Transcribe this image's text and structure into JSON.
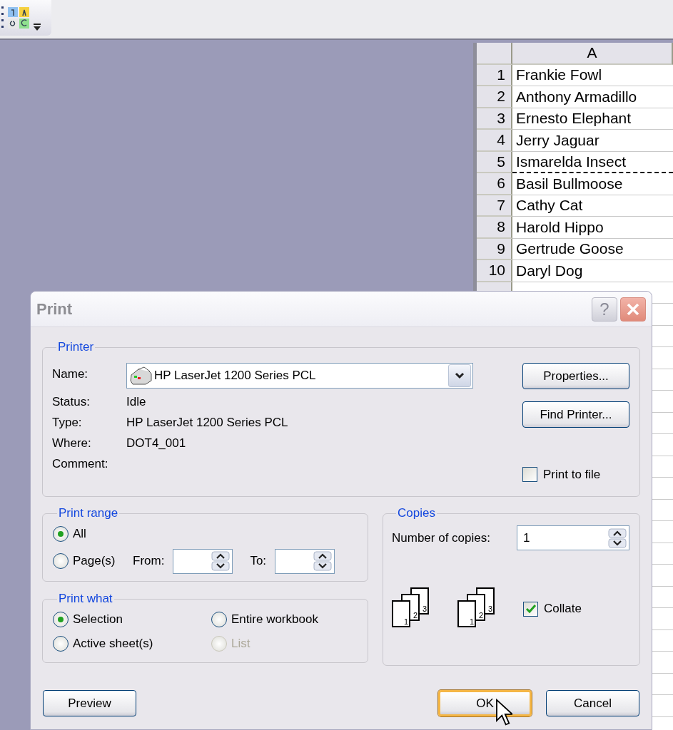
{
  "sheet": {
    "columns": [
      "A"
    ],
    "rows": [
      {
        "number": "1",
        "cells": [
          "Frankie Fowl"
        ],
        "page_break": false
      },
      {
        "number": "2",
        "cells": [
          "Anthony Armadillo"
        ],
        "page_break": false
      },
      {
        "number": "3",
        "cells": [
          "Ernesto Elephant"
        ],
        "page_break": false
      },
      {
        "number": "4",
        "cells": [
          "Jerry Jaguar"
        ],
        "page_break": false
      },
      {
        "number": "5",
        "cells": [
          "Ismarelda Insect"
        ],
        "page_break": true
      },
      {
        "number": "6",
        "cells": [
          "Basil Bullmoose"
        ],
        "page_break": false
      },
      {
        "number": "7",
        "cells": [
          "Cathy Cat"
        ],
        "page_break": false
      },
      {
        "number": "8",
        "cells": [
          "Harold Hippo"
        ],
        "page_break": false
      },
      {
        "number": "9",
        "cells": [
          "Gertrude Goose"
        ],
        "page_break": false
      },
      {
        "number": "10",
        "cells": [
          "Daryl Dog"
        ],
        "page_break": false
      }
    ]
  },
  "dialog": {
    "title": "Print",
    "help": "?",
    "printer": {
      "group_label": "Printer",
      "fields": [
        {
          "label": "Name:",
          "kind": "combo",
          "value": "HP LaserJet 1200 Series PCL"
        },
        {
          "label": "Status:",
          "kind": "text",
          "value": "Idle"
        },
        {
          "label": "Type:",
          "kind": "text",
          "value": "HP LaserJet 1200 Series PCL"
        },
        {
          "label": "Where:",
          "kind": "text",
          "value": "DOT4_001"
        },
        {
          "label": "Comment:",
          "kind": "text"
        }
      ],
      "buttons": [
        "Properties...",
        "Find Printer..."
      ],
      "print_to_file": {
        "label": "Print to file",
        "checked": false
      }
    },
    "print_range": {
      "group_label": "Print range",
      "options": [
        {
          "label": "All",
          "selected": true
        },
        {
          "label": "Page(s)",
          "selected": false
        }
      ],
      "from_label": "From:",
      "to_label": "To:"
    },
    "print_what": {
      "group_label": "Print what",
      "options": [
        {
          "label": "Selection",
          "selected": true,
          "disabled": false
        },
        {
          "label": "Entire workbook",
          "selected": false,
          "disabled": false
        },
        {
          "label": "Active sheet(s)",
          "selected": false,
          "disabled": false
        },
        {
          "label": "List",
          "selected": false,
          "disabled": true
        }
      ]
    },
    "copies": {
      "group_label": "Copies",
      "number_label": "Number of copies:",
      "number": "1",
      "stacks": [
        {
          "pages": [
            "1",
            "2",
            "3"
          ]
        },
        {
          "pages": [
            "1",
            "2",
            "3"
          ]
        }
      ],
      "collate": {
        "label": "Collate",
        "checked": true
      }
    },
    "footer": {
      "left": [
        {
          "label": "Preview",
          "focused": false
        }
      ],
      "right": [
        {
          "label": "OK",
          "focused": true
        },
        {
          "label": "Cancel",
          "focused": false
        }
      ]
    }
  }
}
